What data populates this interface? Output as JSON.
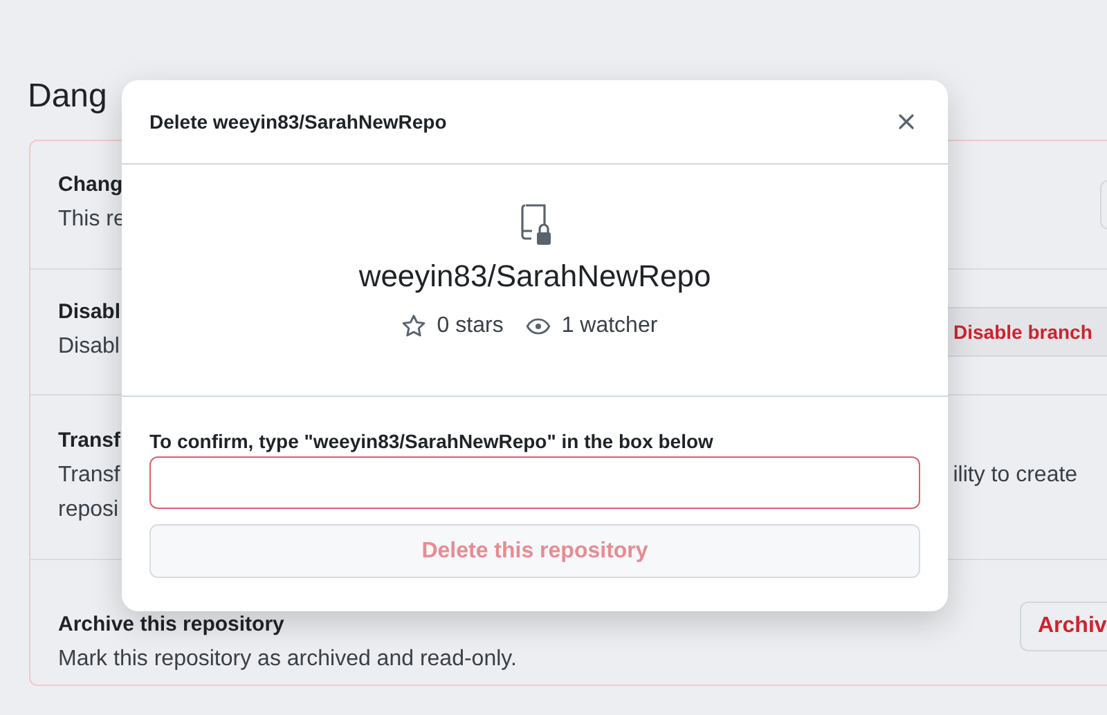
{
  "page": {
    "heading": "Dang",
    "rows": [
      {
        "title": "Chang",
        "lines": [
          [
            "This re"
          ]
        ],
        "button": null,
        "kind": "edge"
      },
      {
        "title": "Disabl",
        "lines": [
          [
            "Disabl"
          ]
        ],
        "button": "Disable branch",
        "kind": "mid"
      },
      {
        "title": "Transf",
        "lines": [
          [
            "Transf",
            "ility to create"
          ],
          [
            "reposi"
          ]
        ],
        "button": null,
        "kind": "none"
      },
      {
        "title": "Archive this repository",
        "lines": [
          [
            "Mark this repository as archived and read-only."
          ]
        ],
        "button": "Archiv",
        "kind": "near"
      }
    ]
  },
  "dialog": {
    "title": "Delete weeyin83/SarahNewRepo",
    "repo_name": "weeyin83/SarahNewRepo",
    "stars": "0 stars",
    "watchers": "1 watcher",
    "confirm_label": "To confirm, type \"weeyin83/SarahNewRepo\" in the box below",
    "input": {
      "error": true
    },
    "confirm_button": {
      "label": "Delete this repository",
      "disabled": true
    }
  }
}
